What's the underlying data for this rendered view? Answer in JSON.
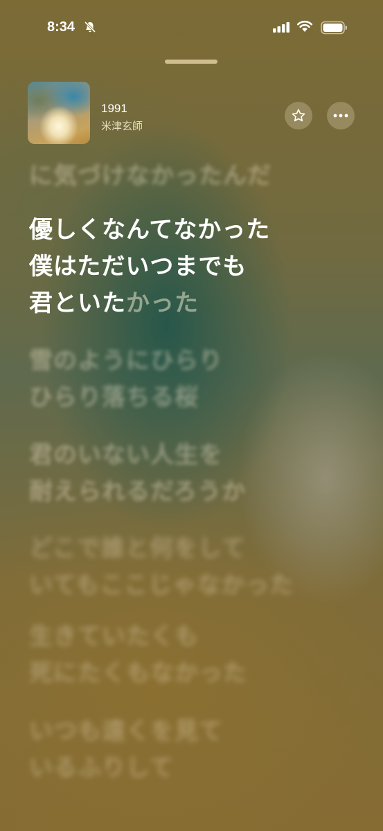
{
  "status_bar": {
    "time": "8:34",
    "icons": [
      "bell-slash-icon",
      "cellular-signal-icon",
      "wifi-icon",
      "battery-icon"
    ]
  },
  "now_playing": {
    "title": "1991",
    "artist": "米津玄師",
    "actions": [
      "star-icon",
      "more-icon"
    ]
  },
  "lyrics": {
    "previous_line": "に気づけなかったんだ",
    "current_verse": {
      "lines": [
        "優しくなんてなかった",
        "僕はただいつまでも"
      ],
      "last_line_sung": "君といた",
      "last_line_pending": "かった"
    },
    "upcoming_verses": [
      [
        "雪のようにひらり",
        "ひらり落ちる桜"
      ],
      [
        "君のいない人生を",
        "耐えられるだろうか"
      ],
      [
        "どこで誰と何をして",
        "いてもここじゃなかった"
      ],
      [
        "生きていたくも",
        "死にたくもなかった"
      ],
      [
        "いつも遠くを見て",
        "いるふりして"
      ]
    ]
  },
  "colors": {
    "background": "#7d6a34",
    "highlight": "#2f5d50",
    "active_text": "#ffffff"
  }
}
